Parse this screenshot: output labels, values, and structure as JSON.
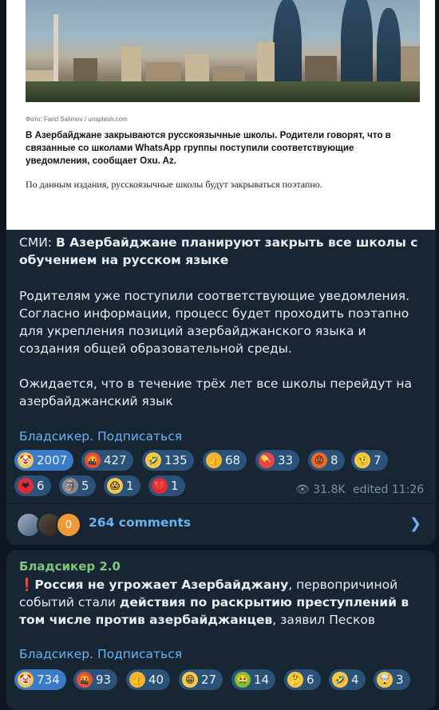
{
  "post1": {
    "article": {
      "photo_credit": "Фото: Farid Salimov / unsplash.com",
      "lead": "В Азербайджане закрываются русскоязычные школы. Родители говорят, что в связанные со школами WhatsApp группы поступили соответствующие уведомления, сообщает Oxu. Az.",
      "body": "По данным издания, русскоязычные школы будут закрываться поэтапно."
    },
    "headline_prefix": "СМИ: ",
    "headline_bold": "В Азербайджане планируют закрыть все школы с обучением на русском языке",
    "para1": "Родителям уже поступили соответствующие уведомления. Согласно информации, процесс будет проходить поэтапно для укрепления позиций азербайджанского языка и создания общей образовательной среды.",
    "para2": "Ожидается, что в течение трёх лет все школы перейдут на азербайджанский язык",
    "signature": "Бладсикер. Подписаться",
    "reactions": [
      {
        "icon": "clown-face-icon",
        "count": "2007",
        "selected": true,
        "color": "#f2c94c"
      },
      {
        "icon": "cursing-face-icon",
        "count": "427",
        "color": "#e0503a"
      },
      {
        "icon": "rofl-face-icon",
        "count": "135",
        "color": "#f5c84a"
      },
      {
        "icon": "thumbs-up-icon",
        "count": "68",
        "color": "#f2b632"
      },
      {
        "icon": "pill-icon",
        "count": "33",
        "color": "#e44848"
      },
      {
        "icon": "angry-face-icon",
        "count": "8",
        "color": "#e86a2a"
      },
      {
        "icon": "raised-eyebrow-face-icon",
        "count": "7",
        "color": "#f5c84a"
      },
      {
        "icon": "red-heart-icon",
        "count": "6",
        "color": "#e02a3a"
      },
      {
        "icon": "moai-icon",
        "count": "5",
        "color": "#8a8a8a"
      },
      {
        "icon": "screaming-face-icon",
        "count": "1",
        "color": "#f5c84a"
      },
      {
        "icon": "broken-heart-icon",
        "count": "1",
        "color": "#e02a3a"
      }
    ],
    "views": "31.8K",
    "edited": "edited 11:26",
    "avatar_badge": "0",
    "comments_label": "264 comments"
  },
  "post2": {
    "author": "Бладсикер 2.0",
    "text_bold1": "Россия не угрожает Азербайджану",
    "text_mid": ", первопричиной событий стали ",
    "text_bold2": "действия по раскрытию преступлений в том числе против азербайджанцев",
    "text_end": ", заявил Песков",
    "signature": "Бладсикер. Подписаться",
    "reactions": [
      {
        "icon": "clown-face-icon",
        "count": "734",
        "selected": true,
        "color": "#f2c94c"
      },
      {
        "icon": "cursing-face-icon",
        "count": "93",
        "color": "#e0503a"
      },
      {
        "icon": "thumbs-up-icon",
        "count": "40",
        "color": "#f2b632"
      },
      {
        "icon": "grinning-face-icon",
        "count": "27",
        "color": "#f5c84a"
      },
      {
        "icon": "vomiting-face-icon",
        "count": "14",
        "color": "#7bbf3a"
      },
      {
        "icon": "thinking-face-icon",
        "count": "6",
        "color": "#f5c84a"
      },
      {
        "icon": "rofl-face-icon",
        "count": "4",
        "color": "#f5c84a"
      },
      {
        "icon": "exploding-head-icon",
        "count": "3",
        "color": "#f5c84a"
      }
    ]
  }
}
